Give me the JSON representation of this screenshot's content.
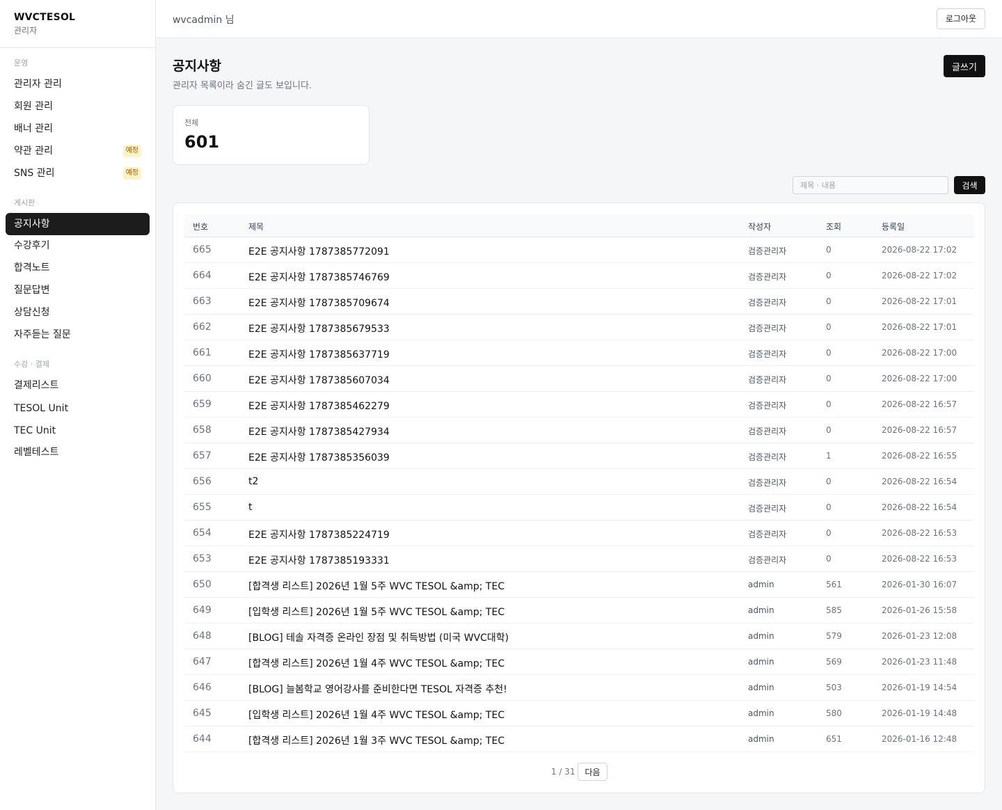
{
  "brand": {
    "title": "WVCTESOL",
    "subtitle": "관리자"
  },
  "sidebar": {
    "sections": [
      {
        "label": "운영"
      },
      {
        "label": "게시판"
      },
      {
        "label": "수강 · 결제"
      }
    ],
    "items": [
      {
        "label": "관리자 관리"
      },
      {
        "label": "회원 관리"
      },
      {
        "label": "배너 관리"
      },
      {
        "label": "약관 관리",
        "badge": "예정"
      },
      {
        "label": "SNS 관리",
        "badge": "예정"
      },
      {
        "label": "공지사항",
        "active": true
      },
      {
        "label": "수강후기"
      },
      {
        "label": "합격노트"
      },
      {
        "label": "질문답변"
      },
      {
        "label": "상담신청"
      },
      {
        "label": "자주듣는 질문"
      },
      {
        "label": "결제리스트"
      },
      {
        "label": "TESOL Unit"
      },
      {
        "label": "TEC Unit"
      },
      {
        "label": "레벨테스트"
      }
    ]
  },
  "header": {
    "user": "wvcadmin 님",
    "logout_label": "로그아웃"
  },
  "page": {
    "title": "공지사항",
    "description": "관리자 목록이라 숨긴 글도 보입니다.",
    "write_label": "글쓰기"
  },
  "stats": {
    "label": "전체",
    "value": "601"
  },
  "search": {
    "placeholder": "제목 · 내용",
    "value": "",
    "button_label": "검색"
  },
  "table": {
    "columns": [
      "번호",
      "제목",
      "작성자",
      "조회",
      "등록일"
    ],
    "rows": [
      {
        "no": "665",
        "title": "E2E 공지사항 1787385772091",
        "author": "검증관리자",
        "views": "0",
        "date": "2026-08-22 17:02"
      },
      {
        "no": "664",
        "title": "E2E 공지사항 1787385746769",
        "author": "검증관리자",
        "views": "0",
        "date": "2026-08-22 17:02"
      },
      {
        "no": "663",
        "title": "E2E 공지사항 1787385709674",
        "author": "검증관리자",
        "views": "0",
        "date": "2026-08-22 17:01"
      },
      {
        "no": "662",
        "title": "E2E 공지사항 1787385679533",
        "author": "검증관리자",
        "views": "0",
        "date": "2026-08-22 17:01"
      },
      {
        "no": "661",
        "title": "E2E 공지사항 1787385637719",
        "author": "검증관리자",
        "views": "0",
        "date": "2026-08-22 17:00"
      },
      {
        "no": "660",
        "title": "E2E 공지사항 1787385607034",
        "author": "검증관리자",
        "views": "0",
        "date": "2026-08-22 17:00"
      },
      {
        "no": "659",
        "title": "E2E 공지사항 1787385462279",
        "author": "검증관리자",
        "views": "0",
        "date": "2026-08-22 16:57"
      },
      {
        "no": "658",
        "title": "E2E 공지사항 1787385427934",
        "author": "검증관리자",
        "views": "0",
        "date": "2026-08-22 16:57"
      },
      {
        "no": "657",
        "title": "E2E 공지사항 1787385356039",
        "author": "검증관리자",
        "views": "1",
        "date": "2026-08-22 16:55"
      },
      {
        "no": "656",
        "title": "t2",
        "author": "검증관리자",
        "views": "0",
        "date": "2026-08-22 16:54"
      },
      {
        "no": "655",
        "title": "t",
        "author": "검증관리자",
        "views": "0",
        "date": "2026-08-22 16:54"
      },
      {
        "no": "654",
        "title": "E2E 공지사항 1787385224719",
        "author": "검증관리자",
        "views": "0",
        "date": "2026-08-22 16:53"
      },
      {
        "no": "653",
        "title": "E2E 공지사항 1787385193331",
        "author": "검증관리자",
        "views": "0",
        "date": "2026-08-22 16:53"
      },
      {
        "no": "650",
        "title": "[합격생 리스트] 2026년 1월 5주 WVC TESOL &amp; TEC",
        "author": "admin",
        "views": "561",
        "date": "2026-01-30 16:07"
      },
      {
        "no": "649",
        "title": "[입학생 리스트] 2026년 1월 5주 WVC TESOL &amp; TEC",
        "author": "admin",
        "views": "585",
        "date": "2026-01-26 15:58"
      },
      {
        "no": "648",
        "title": "[BLOG] 테솔 자격증 온라인 장점 및 취득방법 (미국 WVC대학)",
        "author": "admin",
        "views": "579",
        "date": "2026-01-23 12:08"
      },
      {
        "no": "647",
        "title": "[합격생 리스트] 2026년 1월 4주 WVC TESOL &amp; TEC",
        "author": "admin",
        "views": "569",
        "date": "2026-01-23 11:48"
      },
      {
        "no": "646",
        "title": "[BLOG] 늘봄학교 영어강사를 준비한다면 TESOL 자격증 추천!",
        "author": "admin",
        "views": "503",
        "date": "2026-01-19 14:54"
      },
      {
        "no": "645",
        "title": "[입학생 리스트] 2026년 1월 4주 WVC TESOL &amp; TEC",
        "author": "admin",
        "views": "580",
        "date": "2026-01-19 14:48"
      },
      {
        "no": "644",
        "title": "[합격생 리스트] 2026년 1월 3주 WVC TESOL &amp; TEC",
        "author": "admin",
        "views": "651",
        "date": "2026-01-16 12:48"
      }
    ]
  },
  "pagination": {
    "info": "1 / 31",
    "next_label": "다음"
  }
}
